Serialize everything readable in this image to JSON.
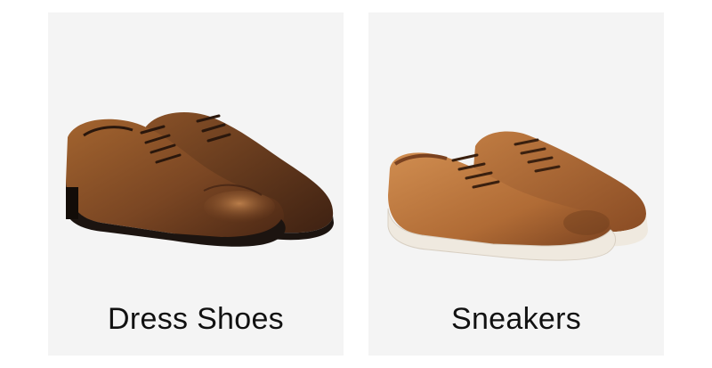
{
  "categories": [
    {
      "label": "Dress Shoes",
      "image": "dress-shoes-photo",
      "colors": {
        "leather": "#7a4623",
        "leather_light": "#a3642f",
        "leather_dark": "#3e2112",
        "sole": "#1c1410"
      }
    },
    {
      "label": "Sneakers",
      "image": "sneakers-photo",
      "colors": {
        "leather": "#b06b35",
        "leather_light": "#cf8a4c",
        "leather_dark": "#6e3d1c",
        "sole": "#efe9df"
      }
    }
  ],
  "theme": {
    "page_background": "#ffffff",
    "card_background": "#f4f4f4",
    "label_color": "#111111"
  }
}
